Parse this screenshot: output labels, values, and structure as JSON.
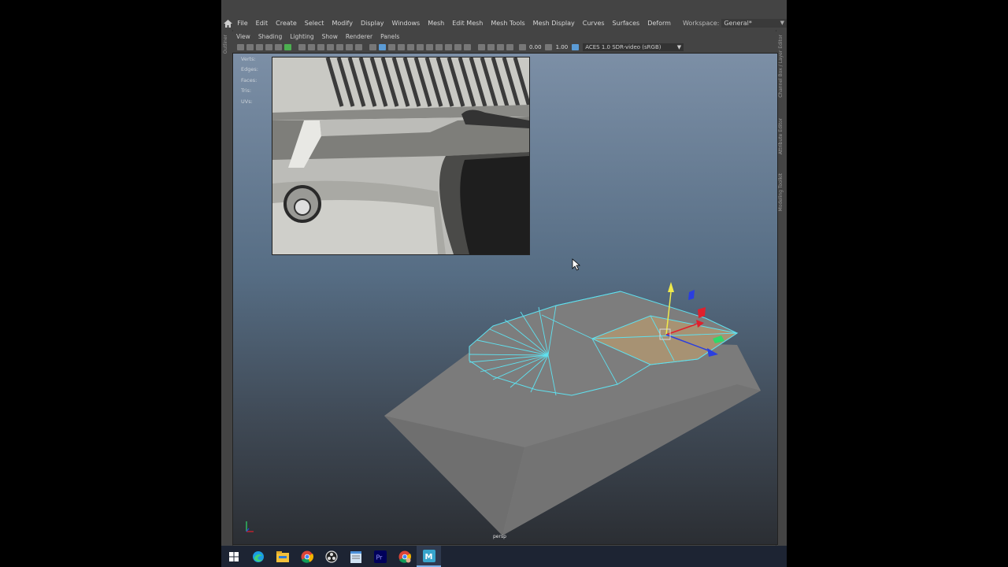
{
  "menubar": {
    "items": [
      "File",
      "Edit",
      "Create",
      "Select",
      "Modify",
      "Display",
      "Windows",
      "Mesh",
      "Edit Mesh",
      "Mesh Tools",
      "Mesh Display",
      "Curves",
      "Surfaces",
      "Deform"
    ],
    "workspace_label": "Workspace:",
    "workspace_value": "General*"
  },
  "panel_menu": [
    "View",
    "Shading",
    "Lighting",
    "Show",
    "Renderer",
    "Panels"
  ],
  "toolbar": {
    "value_a": "0.00",
    "value_b": "1.00",
    "color_space": "ACES 1.0 SDR-video (sRGB)"
  },
  "hud": [
    "Verts:",
    "Edges:",
    "Faces:",
    "Tris:",
    "UVs:"
  ],
  "left_strip": "Outliner",
  "right_strip": [
    "Channel Box / Layer Editor",
    "Attribute Editor",
    "Modeling Toolkit"
  ],
  "camera_label": "persp",
  "taskbar": {
    "icons": [
      "windows-start-icon",
      "edge-icon",
      "file-explorer-icon",
      "chrome-icon",
      "obs-icon",
      "notepad-icon",
      "premiere-icon",
      "chrome-alt-icon",
      "maya-icon"
    ],
    "active": "maya-icon"
  },
  "colors": {
    "wire": "#5fe1ef",
    "mesh": "#7b7b7b",
    "manip_y": "#f0ea4a",
    "manip_x": "#e0202c",
    "manip_z": "#2a3ee0",
    "manip_g": "#2fd86a"
  }
}
